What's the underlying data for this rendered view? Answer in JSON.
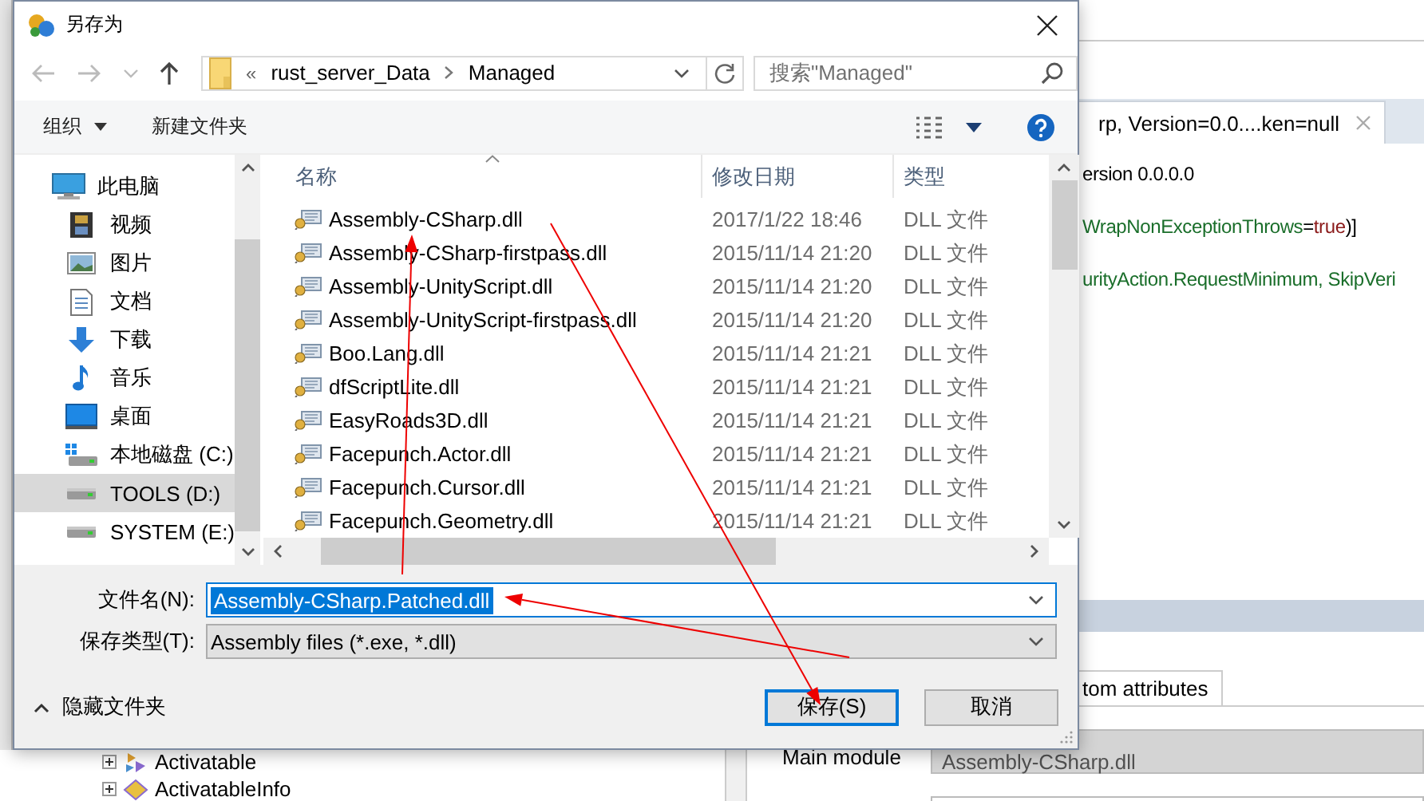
{
  "window": {
    "title": "另存为"
  },
  "address": {
    "overflow": "«",
    "path": [
      "rust_server_Data",
      "Managed"
    ]
  },
  "search": {
    "placeholder": "搜索\"Managed\""
  },
  "toolbar": {
    "organize": "组织",
    "new_folder": "新建文件夹"
  },
  "sidebar": {
    "items": [
      {
        "label": "此电脑",
        "kind": "pc",
        "selected": false,
        "children": [
          {
            "label": "视频",
            "kind": "video",
            "selected": false
          },
          {
            "label": "图片",
            "kind": "picture",
            "selected": false
          },
          {
            "label": "文档",
            "kind": "document",
            "selected": false
          },
          {
            "label": "下载",
            "kind": "download",
            "selected": false
          },
          {
            "label": "音乐",
            "kind": "music",
            "selected": false
          },
          {
            "label": "桌面",
            "kind": "desktop",
            "selected": false
          },
          {
            "label": "本地磁盘 (C:)",
            "kind": "system-drive",
            "selected": false
          },
          {
            "label": "TOOLS (D:)",
            "kind": "drive",
            "selected": true
          },
          {
            "label": "SYSTEM (E:)",
            "kind": "drive",
            "selected": false
          }
        ]
      }
    ]
  },
  "file_list": {
    "columns": [
      {
        "label": "名称",
        "sorted": true
      },
      {
        "label": "修改日期",
        "sorted": false
      },
      {
        "label": "类型",
        "sorted": false
      }
    ],
    "rows": [
      {
        "name": "Assembly-CSharp.dll",
        "modified": "2017/1/22 18:46",
        "type": "DLL 文件"
      },
      {
        "name": "Assembly-CSharp-firstpass.dll",
        "modified": "2015/11/14 21:20",
        "type": "DLL 文件"
      },
      {
        "name": "Assembly-UnityScript.dll",
        "modified": "2015/11/14 21:20",
        "type": "DLL 文件"
      },
      {
        "name": "Assembly-UnityScript-firstpass.dll",
        "modified": "2015/11/14 21:20",
        "type": "DLL 文件"
      },
      {
        "name": "Boo.Lang.dll",
        "modified": "2015/11/14 21:21",
        "type": "DLL 文件"
      },
      {
        "name": "dfScriptLite.dll",
        "modified": "2015/11/14 21:21",
        "type": "DLL 文件"
      },
      {
        "name": "EasyRoads3D.dll",
        "modified": "2015/11/14 21:21",
        "type": "DLL 文件"
      },
      {
        "name": "Facepunch.Actor.dll",
        "modified": "2015/11/14 21:21",
        "type": "DLL 文件"
      },
      {
        "name": "Facepunch.Cursor.dll",
        "modified": "2015/11/14 21:21",
        "type": "DLL 文件"
      },
      {
        "name": "Facepunch.Geometry.dll",
        "modified": "2015/11/14 21:21",
        "type": "DLL 文件"
      }
    ]
  },
  "filename": {
    "label": "文件名(N):",
    "value": "Assembly-CSharp.Patched.dll",
    "selected": true
  },
  "file_type": {
    "label": "保存类型(T):",
    "value": "Assembly files (*.exe, *.dll)"
  },
  "hide_folders": "隐藏文件夹",
  "buttons": [
    {
      "label": "保存(S)",
      "default": true
    },
    {
      "label": "取消",
      "default": false
    }
  ],
  "background": {
    "tab": {
      "title": "rp, Version=0.0....ken=null"
    },
    "code_lines": [
      [
        {
          "text": "ersion 0.0.0.0",
          "kind": "plain"
        }
      ],
      [
        {
          "text": "WrapNonExceptionThrows",
          "kind": "type"
        },
        {
          "text": "=",
          "kind": "plain"
        },
        {
          "text": "true",
          "kind": "keyword"
        },
        {
          "text": ")]",
          "kind": "plain"
        }
      ],
      [
        {
          "text": "urityAction.RequestMinimum, SkipVeri",
          "kind": "type"
        }
      ]
    ],
    "lower_tab": "tom attributes",
    "fields": [
      {
        "label": "Main module",
        "value": "Assembly-CSharp.dll"
      }
    ],
    "tree": [
      {
        "label": "Activatable",
        "kind": "class"
      },
      {
        "label": "ActivatableInfo",
        "kind": "struct"
      }
    ]
  }
}
